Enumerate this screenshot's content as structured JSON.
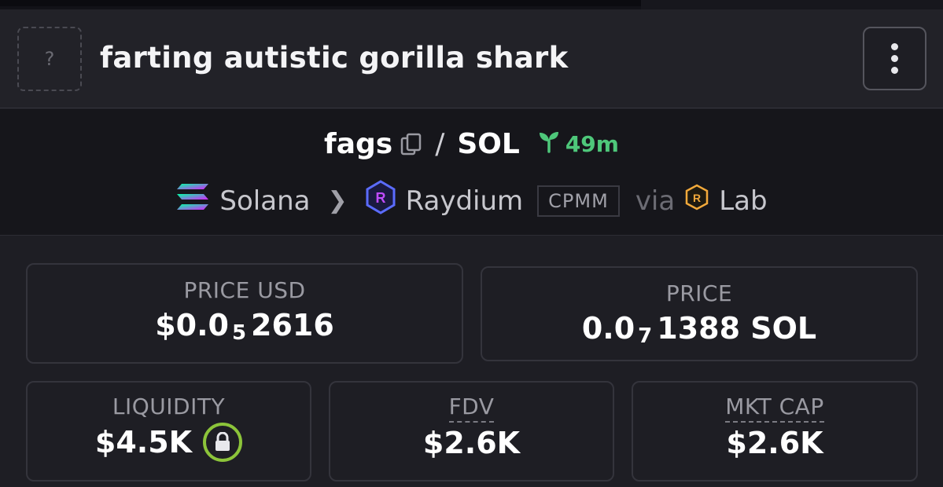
{
  "header": {
    "token_name": "farting autistic gorilla shark",
    "avatar_placeholder": "?"
  },
  "pair": {
    "base_symbol": "fags",
    "separator": "/",
    "quote_symbol": "SOL",
    "age": "49m"
  },
  "chain": {
    "chain_name": "Solana",
    "dex_name": "Raydium",
    "pool_type": "CPMM",
    "via_label": "via",
    "launchpad_name": "Lab"
  },
  "stats": {
    "price_usd": {
      "label": "PRICE USD",
      "prefix": "$0.0",
      "zeros": "5",
      "digits": "2616"
    },
    "price_native": {
      "label": "PRICE",
      "prefix": "0.0",
      "zeros": "7",
      "digits": "1388 SOL"
    },
    "liquidity": {
      "label": "LIQUIDITY",
      "value": "$4.5K"
    },
    "fdv": {
      "label": "FDV",
      "value": "$2.6K"
    },
    "mkt_cap": {
      "label": "MKT CAP",
      "value": "$2.6K"
    }
  },
  "colors": {
    "accent_green": "#4ec77a",
    "lock_ring": "#8cc43a",
    "raydium_blue": "#5b6cff",
    "lab_orange": "#f2a93b"
  },
  "icons": [
    "copy-icon",
    "sprout-icon",
    "solana-logo-icon",
    "chevron-right-icon",
    "raydium-logo-icon",
    "lab-logo-icon",
    "lock-icon",
    "more-vertical-icon"
  ]
}
